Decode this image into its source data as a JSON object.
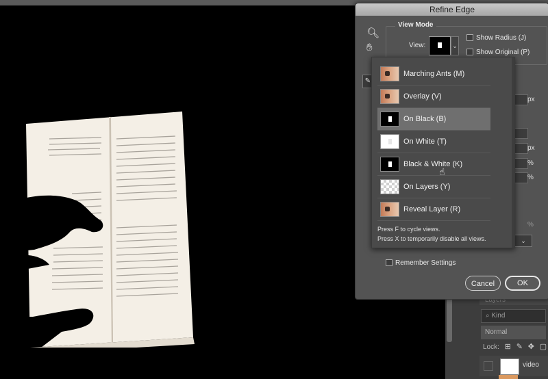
{
  "dialog": {
    "title": "Refine Edge",
    "view_mode": {
      "section_title": "View Mode",
      "view_label": "View:",
      "show_radius": "Show Radius (J)",
      "show_original": "Show Original (P)"
    },
    "units": [
      "px",
      "px",
      "%",
      "%",
      "%"
    ],
    "remember_settings": "Remember Settings",
    "cancel_label": "Cancel",
    "ok_label": "OK"
  },
  "dropdown": {
    "items": [
      {
        "label": "Marching Ants (M)",
        "thumb": "photo"
      },
      {
        "label": "Overlay (V)",
        "thumb": "photo"
      },
      {
        "label": "On Black (B)",
        "thumb": "black",
        "highlighted": true
      },
      {
        "label": "On White (T)",
        "thumb": "white"
      },
      {
        "label": "Black & White (K)",
        "thumb": "bw"
      },
      {
        "label": "On Layers (Y)",
        "thumb": "checker"
      },
      {
        "label": "Reveal Layer (R)",
        "thumb": "photo"
      }
    ],
    "hint_1": "Press F to cycle views.",
    "hint_2": "Press X to temporarily disable all views."
  },
  "layers_panel": {
    "tab": "Layers",
    "kind_filter": "Kind",
    "blend_mode": "Normal",
    "lock_label": "Lock:",
    "layer_name": "video"
  },
  "icons": [
    "zoom-icon",
    "hand-icon",
    "brush-icon",
    "dropdown-arrow-icon",
    "cursor-icon",
    "lock-pixels-icon",
    "lock-brush-icon",
    "lock-move-icon",
    "lock-all-icon"
  ]
}
